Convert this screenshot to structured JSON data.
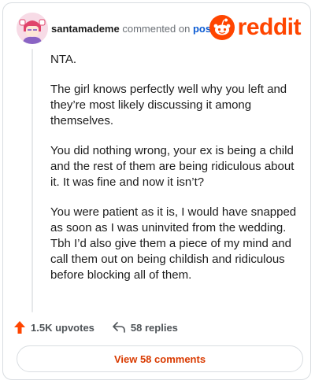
{
  "header": {
    "username": "santamademe",
    "action_text": "commented on",
    "post_link": "post",
    "brand": "reddit"
  },
  "comment": {
    "paragraphs": [
      "NTA.",
      "The girl knows perfectly well why you left and they’re most likely discussing it among themselves.",
      "You did nothing wrong, your ex is being a child and the rest of them are being ridiculous about it. It was fine and now it isn’t?",
      "You were patient as it is, I would have snapped as soon as I was uninvited from the wedding. Tbh I’d also give them a piece of my mind and call them out on being childish and ridiculous before blocking all of them."
    ]
  },
  "footer": {
    "upvotes": "1.5K upvotes",
    "replies": "58 replies"
  },
  "view_button": {
    "label": "View 58 comments"
  },
  "icons": {
    "upvote": "upvote-arrow-icon",
    "reply": "reply-arrow-icon",
    "brand": "reddit-snoo-icon",
    "avatar": "user-avatar"
  },
  "colors": {
    "brand": "#ff4500",
    "link": "#0b5bd3",
    "button_text": "#d93a00",
    "border": "#d9dde1"
  }
}
